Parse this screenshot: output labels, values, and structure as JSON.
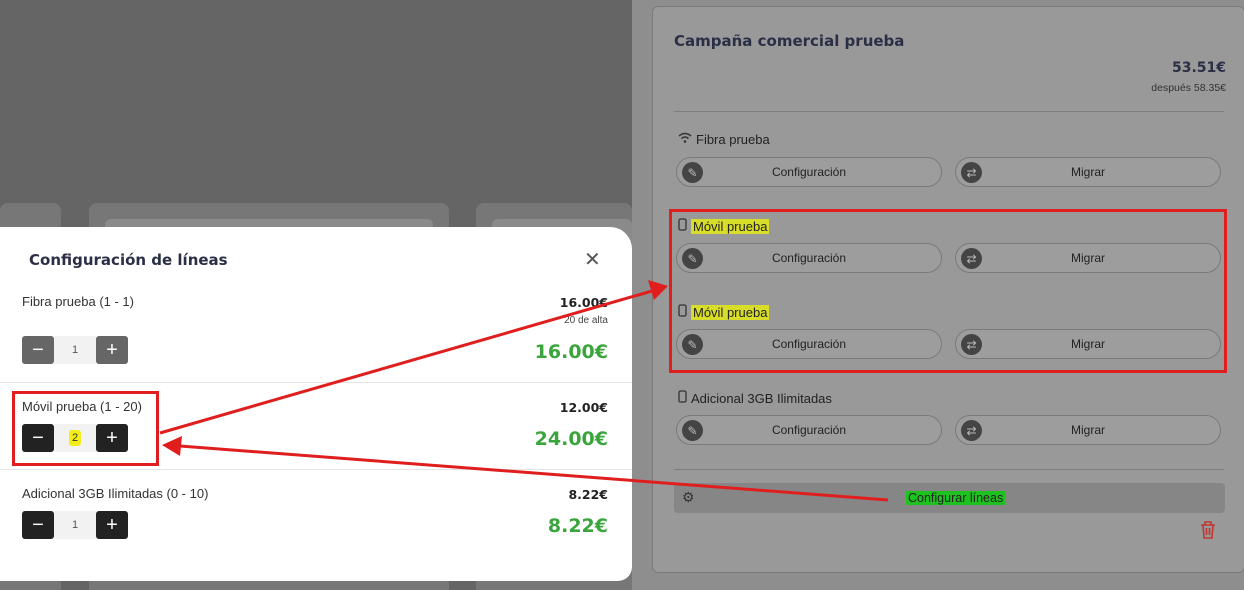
{
  "campaign": {
    "title": "Campaña comercial prueba",
    "price": "53.51€",
    "after_price": "después 58.35€",
    "products": [
      {
        "name": "Fibra prueba",
        "icon": "wifi-icon",
        "config_label": "Configuración",
        "migrate_label": "Migrar"
      },
      {
        "name": "Móvil prueba",
        "icon": "phone-icon",
        "config_label": "Configuración",
        "migrate_label": "Migrar"
      },
      {
        "name": "Móvil prueba",
        "icon": "phone-icon",
        "config_label": "Configuración",
        "migrate_label": "Migrar"
      },
      {
        "name": "Adicional 3GB Ilimitadas",
        "icon": "phone-icon",
        "config_label": "Configuración",
        "migrate_label": "Migrar"
      }
    ],
    "configure_lines_label": "Configurar líneas"
  },
  "modal": {
    "title": "Configuración de líneas",
    "rows": [
      {
        "name": "Fibra prueba (1 - 1)",
        "unit_price": "16.00€",
        "alta": "20 de alta",
        "quantity": "1",
        "total": "16.00€"
      },
      {
        "name": "Móvil prueba (1 - 20)",
        "unit_price": "12.00€",
        "quantity": "2",
        "total": "24.00€"
      },
      {
        "name": "Adicional 3GB Ilimitadas (0 - 10)",
        "unit_price": "8.22€",
        "quantity": "1",
        "total": "8.22€"
      }
    ]
  },
  "colors": {
    "annotation_red": "#e01e1e",
    "highlight_yellow": "#d8dd2a",
    "highlight_green": "#1ec21e",
    "price_green": "#3aa53d"
  }
}
